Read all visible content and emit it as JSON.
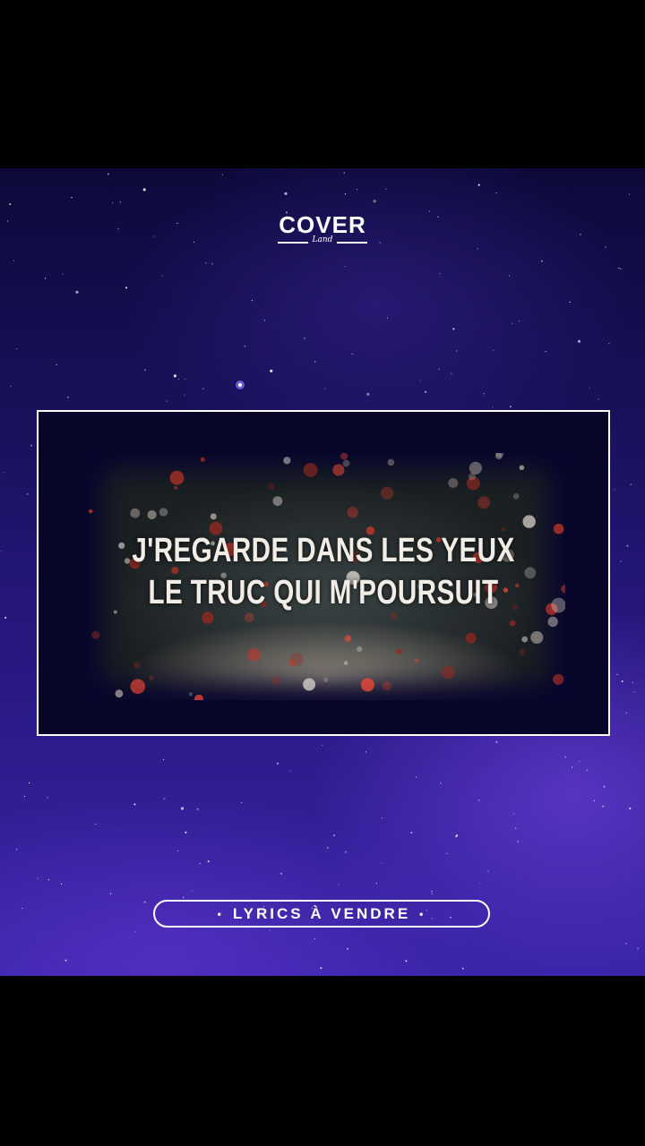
{
  "logo": {
    "main": "COVER",
    "sub": "Land"
  },
  "lyrics": {
    "line1": "J'REGARDE DANS LES YEUX",
    "line2": "LE TRUC QUI M'POURSUIT"
  },
  "badge": {
    "label": "LYRICS À VENDRE",
    "bullet": "•"
  },
  "colors": {
    "background_top": "#0d0a3a",
    "background_bottom": "#3a24a8",
    "frame_border": "#ffffff",
    "letterbox": "#000000"
  }
}
